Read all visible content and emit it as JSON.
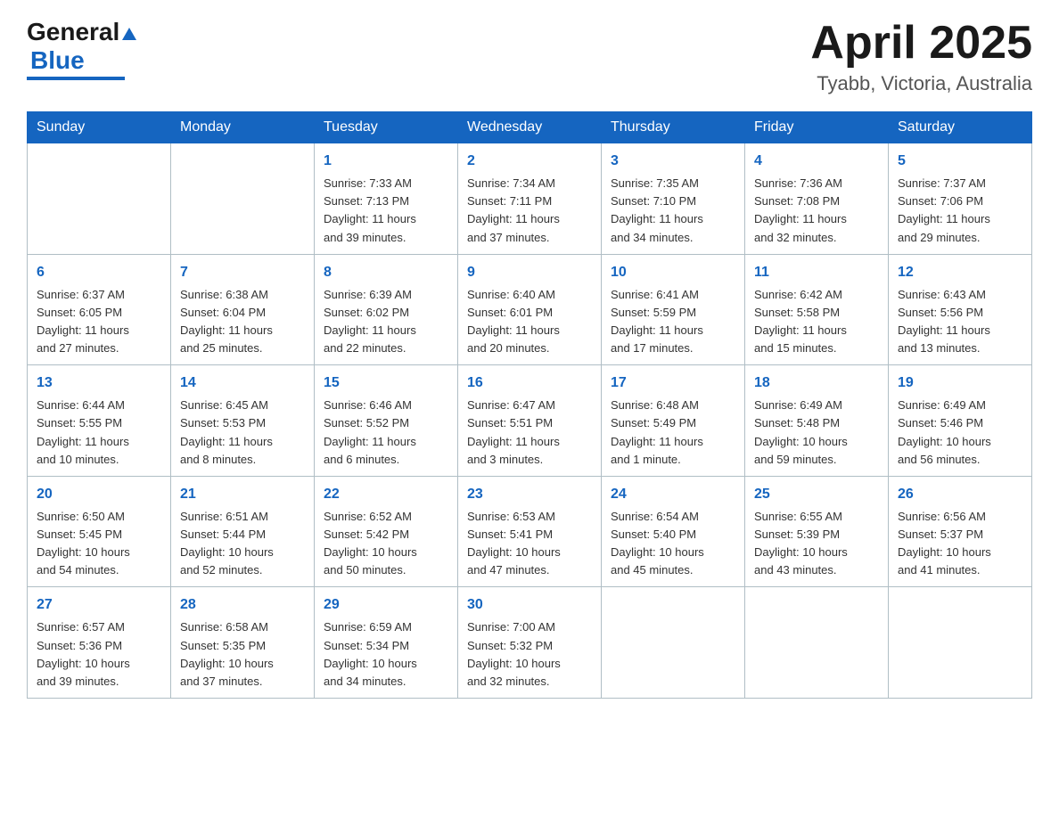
{
  "header": {
    "logo_general": "General",
    "logo_blue": "Blue",
    "title": "April 2025",
    "location": "Tyabb, Victoria, Australia"
  },
  "weekdays": [
    "Sunday",
    "Monday",
    "Tuesday",
    "Wednesday",
    "Thursday",
    "Friday",
    "Saturday"
  ],
  "weeks": [
    [
      {
        "day": "",
        "info": ""
      },
      {
        "day": "",
        "info": ""
      },
      {
        "day": "1",
        "info": "Sunrise: 7:33 AM\nSunset: 7:13 PM\nDaylight: 11 hours\nand 39 minutes."
      },
      {
        "day": "2",
        "info": "Sunrise: 7:34 AM\nSunset: 7:11 PM\nDaylight: 11 hours\nand 37 minutes."
      },
      {
        "day": "3",
        "info": "Sunrise: 7:35 AM\nSunset: 7:10 PM\nDaylight: 11 hours\nand 34 minutes."
      },
      {
        "day": "4",
        "info": "Sunrise: 7:36 AM\nSunset: 7:08 PM\nDaylight: 11 hours\nand 32 minutes."
      },
      {
        "day": "5",
        "info": "Sunrise: 7:37 AM\nSunset: 7:06 PM\nDaylight: 11 hours\nand 29 minutes."
      }
    ],
    [
      {
        "day": "6",
        "info": "Sunrise: 6:37 AM\nSunset: 6:05 PM\nDaylight: 11 hours\nand 27 minutes."
      },
      {
        "day": "7",
        "info": "Sunrise: 6:38 AM\nSunset: 6:04 PM\nDaylight: 11 hours\nand 25 minutes."
      },
      {
        "day": "8",
        "info": "Sunrise: 6:39 AM\nSunset: 6:02 PM\nDaylight: 11 hours\nand 22 minutes."
      },
      {
        "day": "9",
        "info": "Sunrise: 6:40 AM\nSunset: 6:01 PM\nDaylight: 11 hours\nand 20 minutes."
      },
      {
        "day": "10",
        "info": "Sunrise: 6:41 AM\nSunset: 5:59 PM\nDaylight: 11 hours\nand 17 minutes."
      },
      {
        "day": "11",
        "info": "Sunrise: 6:42 AM\nSunset: 5:58 PM\nDaylight: 11 hours\nand 15 minutes."
      },
      {
        "day": "12",
        "info": "Sunrise: 6:43 AM\nSunset: 5:56 PM\nDaylight: 11 hours\nand 13 minutes."
      }
    ],
    [
      {
        "day": "13",
        "info": "Sunrise: 6:44 AM\nSunset: 5:55 PM\nDaylight: 11 hours\nand 10 minutes."
      },
      {
        "day": "14",
        "info": "Sunrise: 6:45 AM\nSunset: 5:53 PM\nDaylight: 11 hours\nand 8 minutes."
      },
      {
        "day": "15",
        "info": "Sunrise: 6:46 AM\nSunset: 5:52 PM\nDaylight: 11 hours\nand 6 minutes."
      },
      {
        "day": "16",
        "info": "Sunrise: 6:47 AM\nSunset: 5:51 PM\nDaylight: 11 hours\nand 3 minutes."
      },
      {
        "day": "17",
        "info": "Sunrise: 6:48 AM\nSunset: 5:49 PM\nDaylight: 11 hours\nand 1 minute."
      },
      {
        "day": "18",
        "info": "Sunrise: 6:49 AM\nSunset: 5:48 PM\nDaylight: 10 hours\nand 59 minutes."
      },
      {
        "day": "19",
        "info": "Sunrise: 6:49 AM\nSunset: 5:46 PM\nDaylight: 10 hours\nand 56 minutes."
      }
    ],
    [
      {
        "day": "20",
        "info": "Sunrise: 6:50 AM\nSunset: 5:45 PM\nDaylight: 10 hours\nand 54 minutes."
      },
      {
        "day": "21",
        "info": "Sunrise: 6:51 AM\nSunset: 5:44 PM\nDaylight: 10 hours\nand 52 minutes."
      },
      {
        "day": "22",
        "info": "Sunrise: 6:52 AM\nSunset: 5:42 PM\nDaylight: 10 hours\nand 50 minutes."
      },
      {
        "day": "23",
        "info": "Sunrise: 6:53 AM\nSunset: 5:41 PM\nDaylight: 10 hours\nand 47 minutes."
      },
      {
        "day": "24",
        "info": "Sunrise: 6:54 AM\nSunset: 5:40 PM\nDaylight: 10 hours\nand 45 minutes."
      },
      {
        "day": "25",
        "info": "Sunrise: 6:55 AM\nSunset: 5:39 PM\nDaylight: 10 hours\nand 43 minutes."
      },
      {
        "day": "26",
        "info": "Sunrise: 6:56 AM\nSunset: 5:37 PM\nDaylight: 10 hours\nand 41 minutes."
      }
    ],
    [
      {
        "day": "27",
        "info": "Sunrise: 6:57 AM\nSunset: 5:36 PM\nDaylight: 10 hours\nand 39 minutes."
      },
      {
        "day": "28",
        "info": "Sunrise: 6:58 AM\nSunset: 5:35 PM\nDaylight: 10 hours\nand 37 minutes."
      },
      {
        "day": "29",
        "info": "Sunrise: 6:59 AM\nSunset: 5:34 PM\nDaylight: 10 hours\nand 34 minutes."
      },
      {
        "day": "30",
        "info": "Sunrise: 7:00 AM\nSunset: 5:32 PM\nDaylight: 10 hours\nand 32 minutes."
      },
      {
        "day": "",
        "info": ""
      },
      {
        "day": "",
        "info": ""
      },
      {
        "day": "",
        "info": ""
      }
    ]
  ]
}
